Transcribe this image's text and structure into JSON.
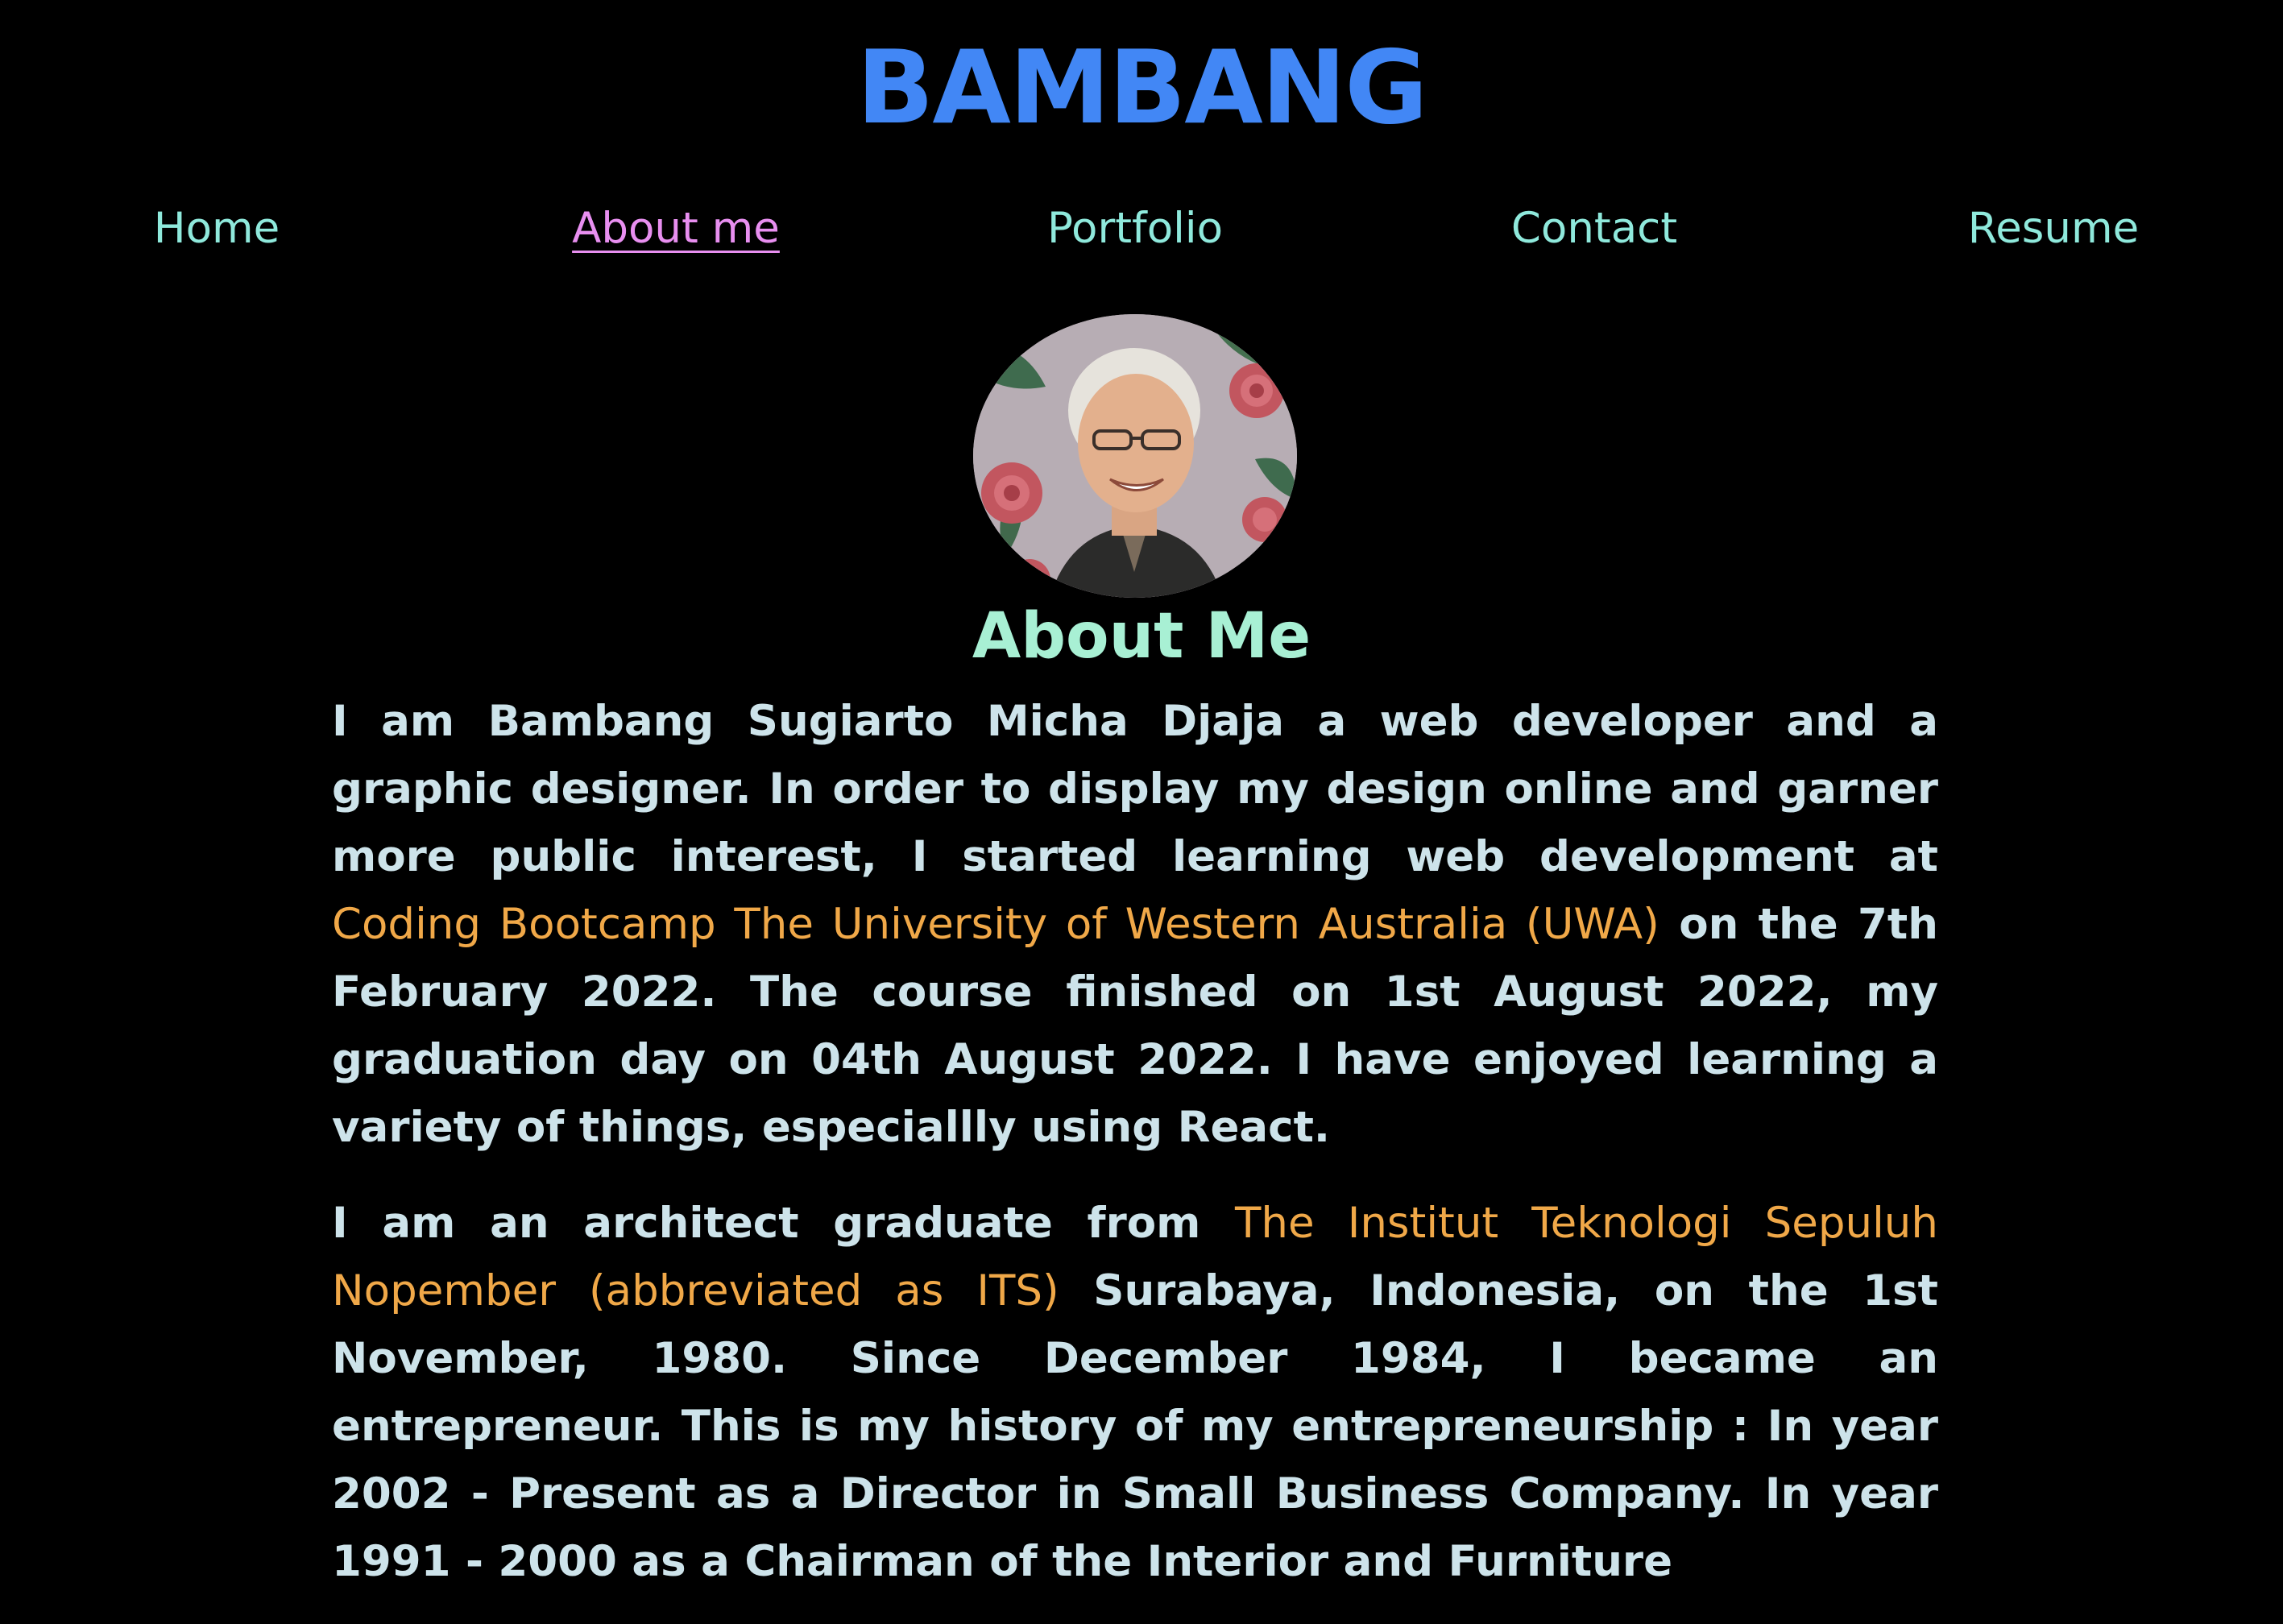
{
  "header": {
    "title": "BAMBANG"
  },
  "nav": {
    "items": [
      {
        "label": "Home"
      },
      {
        "label": "About me"
      },
      {
        "label": "Portfolio"
      },
      {
        "label": "Contact"
      },
      {
        "label": "Resume"
      }
    ],
    "active_index": 1
  },
  "about": {
    "heading": "About Me",
    "p1": {
      "text_a": "I am Bambang Sugiarto Micha Djaja a web developer and a graphic designer. In order to display my design online and garner more public interest, I started learning web development at ",
      "link": "Coding Bootcamp The University of Western Australia (UWA)",
      "text_b": " on the 7th February 2022. The course finished on 1st August 2022, my graduation day on 04th August 2022. I have enjoyed learning a variety of things, especiallly using React."
    },
    "p2": {
      "text_a": "I am an architect graduate from ",
      "link": "The Institut Teknologi Sepuluh Nopember (abbreviated as ITS)",
      "text_b": " Surabaya, Indonesia, on the 1st November, 1980. Since December 1984, I became an entrepreneur. This is my history of my entrepreneurship : In year 2002 - Present as a Director in Small Business Company. In year 1991 - 2000 as a Chairman of the Interior and Furniture"
    }
  },
  "colors": {
    "background": "#000000",
    "title": "#4287f5",
    "nav_link": "#8fe9dc",
    "nav_active": "#e88ff0",
    "heading": "#a8f0d4",
    "body_text": "#cde3ea",
    "link_text": "#f0a848"
  }
}
